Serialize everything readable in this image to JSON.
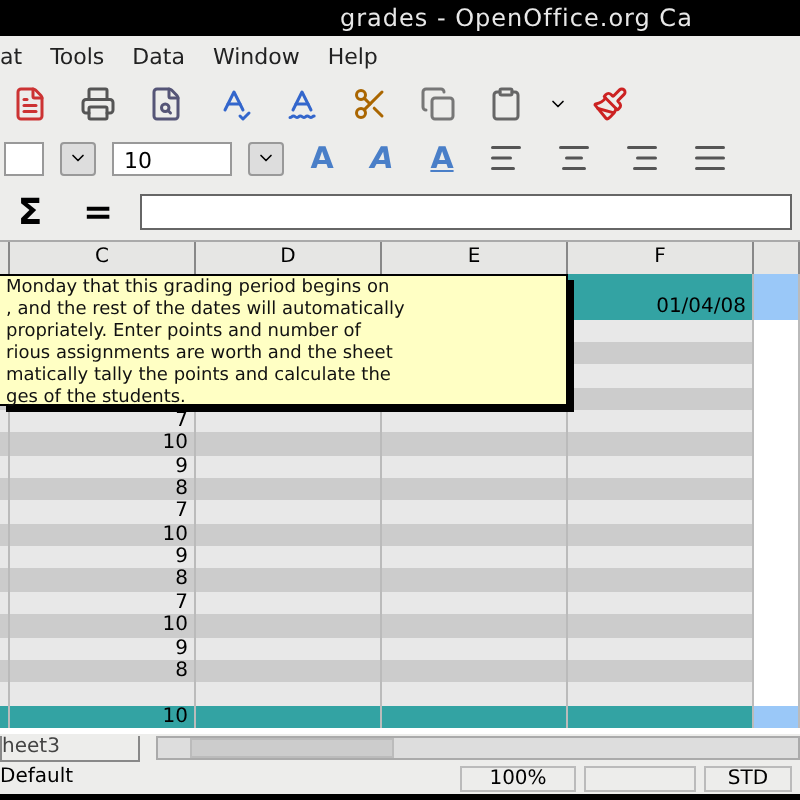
{
  "window": {
    "title": "grades - OpenOffice.org Ca"
  },
  "menu": [
    "at",
    "Tools",
    "Data",
    "Window",
    "Help"
  ],
  "format_toolbar": {
    "font_size": "10",
    "style_buttons": [
      {
        "label": "A",
        "kind": "bold"
      },
      {
        "label": "A",
        "kind": "italic"
      },
      {
        "label": "A",
        "kind": "underline"
      }
    ]
  },
  "formula_bar": {
    "sum_symbol": "Σ",
    "equals_symbol": "="
  },
  "columns": [
    "C",
    "D",
    "E",
    "F"
  ],
  "rows": [
    {
      "kind": "header",
      "c": "",
      "f": ""
    },
    {
      "kind": "header",
      "c": "",
      "f": "01/04/08"
    },
    {
      "kind": "data",
      "c": "",
      "f": ""
    },
    {
      "kind": "data",
      "c": "",
      "f": ""
    },
    {
      "kind": "data",
      "c": "",
      "f": ""
    },
    {
      "kind": "data",
      "c": "",
      "f": ""
    },
    {
      "kind": "data",
      "c": "7",
      "f": ""
    },
    {
      "kind": "data",
      "c": "10",
      "f": ""
    },
    {
      "kind": "data",
      "c": "9",
      "f": ""
    },
    {
      "kind": "data",
      "c": "8",
      "f": ""
    },
    {
      "kind": "data",
      "c": "7",
      "f": ""
    },
    {
      "kind": "data",
      "c": "10",
      "f": ""
    },
    {
      "kind": "data",
      "c": "9",
      "f": ""
    },
    {
      "kind": "data",
      "c": "8",
      "f": ""
    },
    {
      "kind": "data",
      "c": "7",
      "f": ""
    },
    {
      "kind": "data",
      "c": "10",
      "f": ""
    },
    {
      "kind": "data",
      "c": "9",
      "f": ""
    },
    {
      "kind": "data",
      "c": "8",
      "f": ""
    },
    {
      "kind": "data",
      "c": "",
      "f": ""
    },
    {
      "kind": "total",
      "c": "10",
      "f": ""
    }
  ],
  "comment": {
    "lines": [
      "Monday that this grading period begins on",
      ", and the rest of the dates will automatically",
      "propriately. Enter points and number of",
      "rious assignments are worth and the sheet",
      "matically tally the points and calculate the",
      "ges of the students."
    ]
  },
  "sheet_tabs": [
    {
      "label": "heet3",
      "selected": false
    }
  ],
  "status_bar": {
    "page_style": "Default",
    "zoom": "100%",
    "mode": "STD"
  }
}
